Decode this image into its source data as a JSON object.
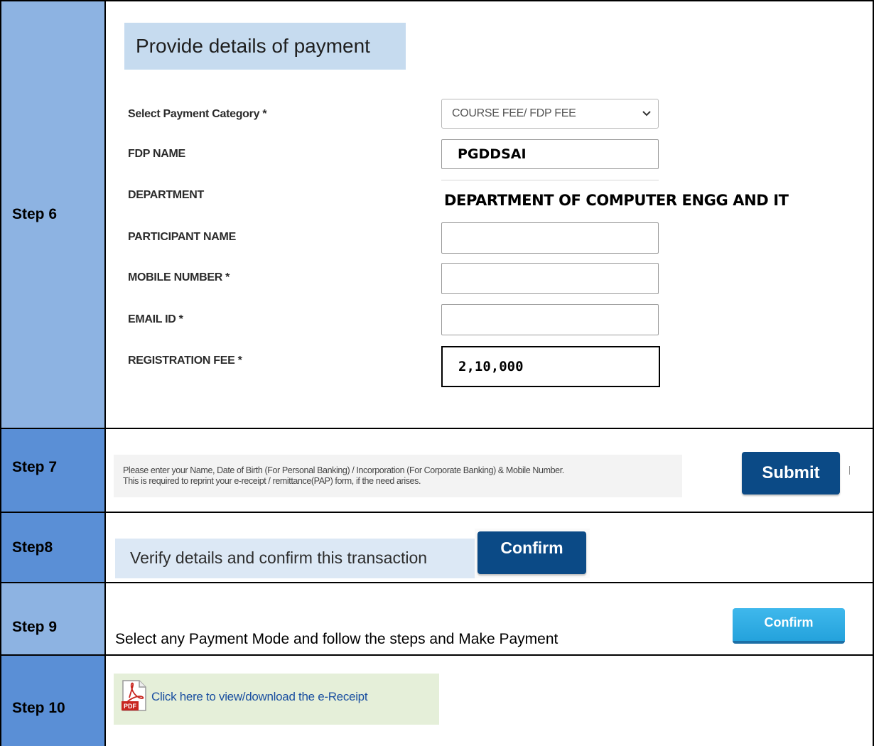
{
  "steps": {
    "step6": "Step 6",
    "step7": "Step 7",
    "step8": "Step8",
    "step9": "Step 9",
    "step10": "Step 10"
  },
  "payment_form": {
    "heading": "Provide details of payment",
    "category_label": "Select Payment Category *",
    "category_value": "COURSE FEE/ FDP FEE",
    "fdp_name_label": "FDP NAME",
    "fdp_name_value": "PGDDSAI",
    "department_label": "DEPARTMENT",
    "department_value": "DEPARTMENT OF COMPUTER ENGG AND IT",
    "participant_label": "PARTICIPANT NAME",
    "participant_value": "",
    "mobile_label": "MOBILE NUMBER *",
    "mobile_value": "",
    "email_label": "EMAIL ID *",
    "email_value": "",
    "fee_label": "REGISTRATION FEE *",
    "fee_value": "2,10,000"
  },
  "step7": {
    "line1": "Please enter your Name, Date of Birth (For Personal Banking) / Incorporation (For Corporate Banking)  & Mobile Number.",
    "line2": "This is required to reprint your e-receipt / remittance(PAP) form, if the need arises.",
    "submit_label": "Submit"
  },
  "step8": {
    "text": "Verify details and confirm this transaction",
    "confirm_label": "Confirm"
  },
  "step9": {
    "text": "Select any Payment Mode and follow the steps and Make Payment",
    "confirm_label": "Confirm"
  },
  "step10": {
    "link_text": "Click here to view/download the e-Receipt",
    "pdf_icon_text": "PDF"
  },
  "colors": {
    "step_light": "#8db3e2",
    "step_dark": "#5a8fd6",
    "button_dark": "#0b4a86",
    "button_light": "#24a2dc"
  }
}
